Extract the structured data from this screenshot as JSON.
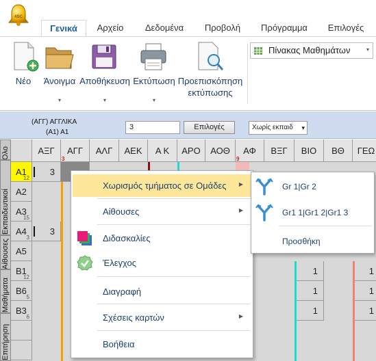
{
  "app": {
    "orb_label": "4SC"
  },
  "tabs": [
    {
      "label": "Γενικά",
      "active": true
    },
    {
      "label": "Αρχείο"
    },
    {
      "label": "Δεδομένα"
    },
    {
      "label": "Προβολή"
    },
    {
      "label": "Πρόγραμμα"
    },
    {
      "label": "Επιλογές"
    }
  ],
  "ribbon": {
    "new": {
      "label": "Νέο",
      "icon": "new-document-icon"
    },
    "open": {
      "label": "Άνοιγμα",
      "icon": "folder-icon"
    },
    "save": {
      "label": "Αποθήκευση",
      "icon": "floppy-disk-icon"
    },
    "print": {
      "label": "Εκτύπωση",
      "icon": "printer-icon"
    },
    "preview": {
      "label_line1": "Προεπισκόπηση",
      "label_line2": "εκτύπωσης",
      "icon": "print-preview-icon"
    },
    "dropdown_arrow": "▾",
    "view_combo": {
      "value": "Πίνακας Μαθημάτων",
      "icon": "grid-icon"
    }
  },
  "options_bar": {
    "lesson_line1": "(ΑΓΓ) ΑΓΓΛΙΚΑ",
    "lesson_line2": "(Α1) Α1",
    "hours_value": "3",
    "options_button": "Επιλογές",
    "teacher_select": "Χωρίς εκπαιδ",
    "select_arrow": "▾"
  },
  "side_tabs": [
    "Όλο",
    "Εκπαιδευτικοί",
    "Αίθουσες",
    "Μαθήματα",
    "Επιτήρηση"
  ],
  "columns": [
    "ΑΞΓ",
    "ΑΓΓ",
    "ΑΛΓ",
    "ΑΕΚ",
    "Α Κ",
    "ΑΡΟ",
    "ΑΟΘ",
    "ΑΦ",
    "ΒΞΓ",
    "ΒΙΟ",
    "ΒΘ",
    "ΓΕΩ"
  ],
  "column_marks": {
    "ΑΓΓ": "3",
    "ΑΦ": "9"
  },
  "rows": [
    {
      "label": "Α1",
      "num": "12",
      "selected": true,
      "cells": {
        "ΑΞΓ": "3"
      }
    },
    {
      "label": "Α2",
      "num": "",
      "cells": {}
    },
    {
      "label": "Α3",
      "num": "15",
      "cells": {}
    },
    {
      "label": "Α4",
      "num": "3",
      "cells": {
        "ΑΞΓ": "3"
      }
    },
    {
      "label": "Α5",
      "num": "",
      "cells": {}
    },
    {
      "label": "Β1",
      "num": "12",
      "cells": {
        "ΒΙΟ": "1",
        "ΓΕΩ": "1"
      }
    },
    {
      "label": "Β6",
      "num": "5",
      "cells": {
        "ΒΙΟ": "1",
        "ΓΕΩ": "1"
      }
    },
    {
      "label": "Β3",
      "num": "6",
      "cells": {
        "ΒΙΟ": "1",
        "ΓΕΩ": "1"
      }
    }
  ],
  "stripe_colors": {
    "orange": "#f7a000",
    "cyan": "#20d8d0",
    "salmon": "#f08070",
    "darkred": "#8b1010"
  },
  "context_menu": {
    "items": [
      {
        "label": "Χωρισμός τμήματος σε Ομάδες",
        "submenu": true,
        "highlighted": true
      },
      {
        "label": "Αίθουσες",
        "submenu": true
      },
      {
        "label": "Διδασκαλίες",
        "icon": "teachings-icon"
      },
      {
        "label": "Έλεγχος",
        "icon": "check-icon"
      },
      {
        "label": "Διαγραφή"
      },
      {
        "label": "Σχέσεις καρτών",
        "submenu": true
      },
      {
        "label": "Βοήθεια"
      }
    ],
    "submenu_arrow": "▶"
  },
  "group_submenu": {
    "items": [
      {
        "label": "Gr 1|Gr 2",
        "icon": "split-icon"
      },
      {
        "label": "Gr1 1|Gr1 2|Gr1 3",
        "icon": "split-icon"
      },
      {
        "label": "Προσθήκη"
      }
    ]
  }
}
